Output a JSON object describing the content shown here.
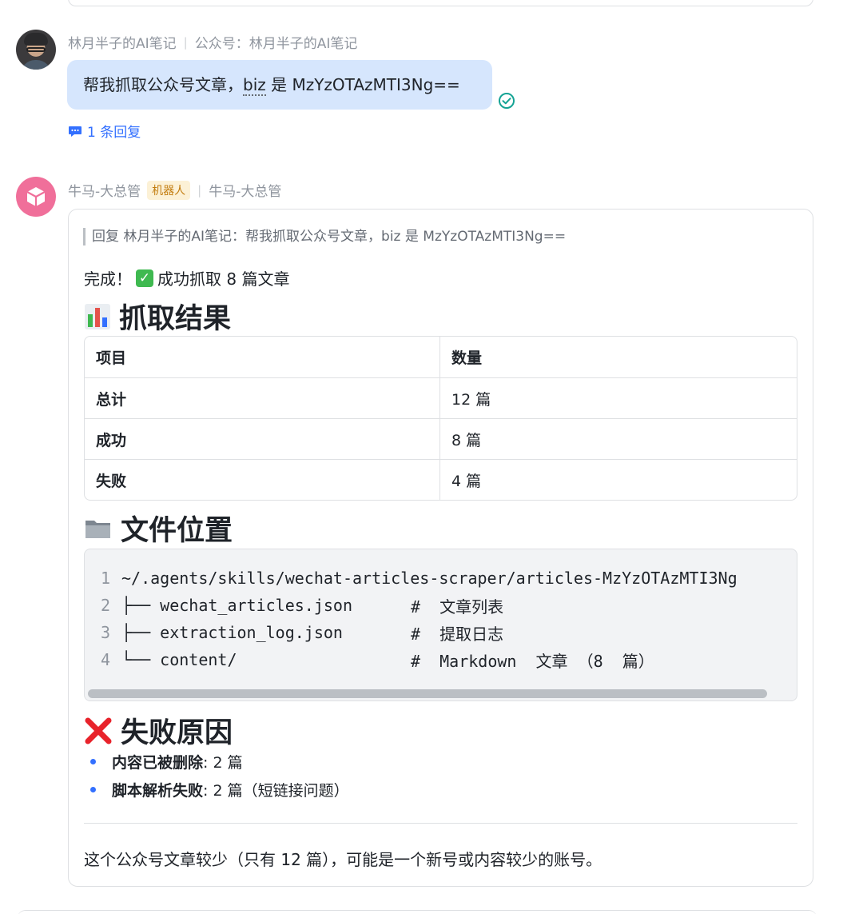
{
  "messages": {
    "user": {
      "name": "林月半子的AI笔记",
      "channel": "公众号：林月半子的AI笔记",
      "text_prefix": "帮我抓取公众号文章，",
      "text_biz": "biz",
      "text_suffix": " 是 MzYzOTAzMTI3Ng==",
      "reply_count": "1 条回复"
    },
    "bot": {
      "name": "牛马-大总管",
      "tag": "机器人",
      "channel": "牛马-大总管",
      "quote": "回复 林月半子的AI笔记：帮我抓取公众号文章，biz 是 MzYzOTAzMTI3Ng==",
      "done_prefix": "完成！",
      "done_text": "成功抓取 8 篇文章",
      "results_heading": "抓取结果",
      "table": {
        "headers": [
          "项目",
          "数量"
        ],
        "rows": [
          [
            "总计",
            "12 篇"
          ],
          [
            "成功",
            "8 篇"
          ],
          [
            "失败",
            "4 篇"
          ]
        ]
      },
      "files_heading": "文件位置",
      "code": [
        {
          "n": "1",
          "text": "~/.agents/skills/wechat-articles-scraper/articles-MzYzOTAzMTI3Ng",
          "comment": ""
        },
        {
          "n": "2",
          "text": "├── wechat_articles.json",
          "comment": "#  文章列表"
        },
        {
          "n": "3",
          "text": "├── extraction_log.json",
          "comment": "#  提取日志"
        },
        {
          "n": "4",
          "text": "└── content/",
          "comment": "#  Markdown  文章 （8  篇）"
        }
      ],
      "fail_heading": "失败原因",
      "fail_reasons": [
        {
          "label": "内容已被删除",
          "value": ": 2 篇"
        },
        {
          "label": "脚本解析失败",
          "value": ": 2 篇（短链接问题）"
        }
      ],
      "footer": "这个公众号文章较少（只有 12 篇），可能是一个新号或内容较少的账号。"
    }
  },
  "colors": {
    "accent": "#3370ff",
    "bubble": "#d6e6fd",
    "bot_avatar": "#f06f9a",
    "robot_tag_bg": "#fcf1d6",
    "robot_tag_text": "#c27c0e",
    "read_check": "#14a394"
  },
  "icons": {
    "results": "bar-chart-icon",
    "files": "folder-icon",
    "fail": "cross-mark-icon",
    "reply": "comment-icon",
    "read": "read-check-icon"
  }
}
